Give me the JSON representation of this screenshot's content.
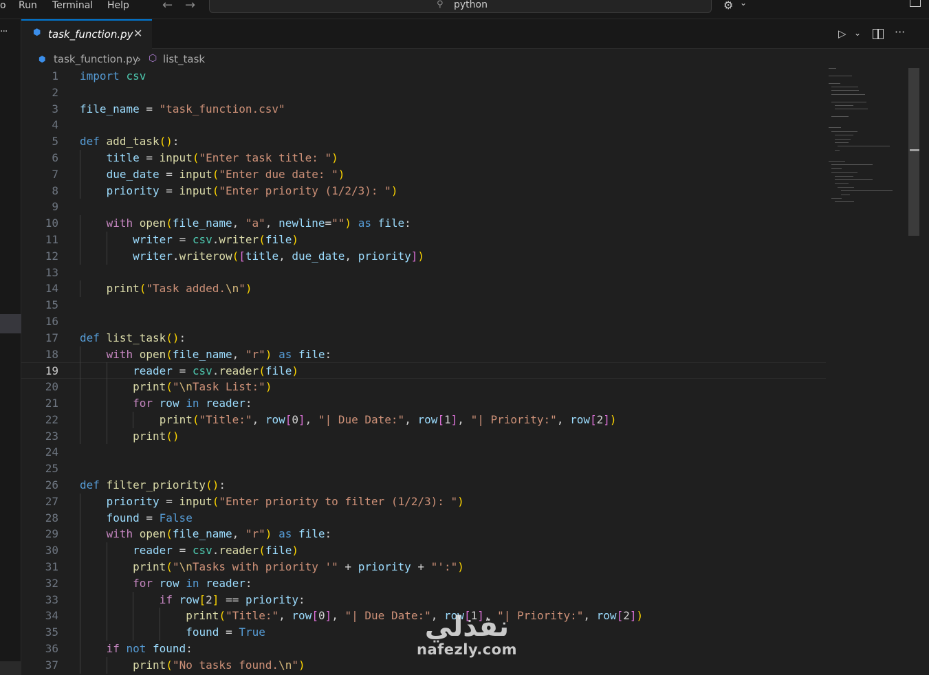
{
  "menu": {
    "items": [
      "o",
      "Run",
      "Terminal",
      "Help"
    ],
    "back_icon": "arrow-left-icon",
    "forward_icon": "arrow-right-icon",
    "command_center": "python"
  },
  "tab": {
    "filename": "task_function.py",
    "close_glyph": "✕"
  },
  "breadcrumb": {
    "file": "task_function.py",
    "separator": "›",
    "symbol": "list_task"
  },
  "editor": {
    "active_line": 19,
    "lines": [
      "import csv",
      "",
      "file_name = \"task_function.csv\"",
      "",
      "def add_task():",
      "    title = input(\"Enter task title: \")",
      "    due_date = input(\"Enter due date: \")",
      "    priority = input(\"Enter priority (1/2/3): \")",
      "",
      "    with open(file_name, \"a\", newline=\"\") as file:",
      "        writer = csv.writer(file)",
      "        writer.writerow([title, due_date, priority])",
      "",
      "    print(\"Task added.\\n\")",
      "",
      "",
      "def list_task():",
      "    with open(file_name, \"r\") as file:",
      "        reader = csv.reader(file)",
      "        print(\"\\nTask List:\")",
      "        for row in reader:",
      "            print(\"Title:\", row[0], \"| Due Date:\", row[1], \"| Priority:\", row[2])",
      "        print()",
      "",
      "",
      "def filter_priority():",
      "    priority = input(\"Enter priority to filter (1/2/3): \")",
      "    found = False",
      "    with open(file_name, \"r\") as file:",
      "        reader = csv.reader(file)",
      "        print(\"\\nTasks with priority '\" + priority + \"':\")",
      "        for row in reader:",
      "            if row[2] == priority:",
      "                print(\"Title:\", row[0], \"| Due Date:\", row[1], \"| Priority:\", row[2])",
      "                found = True",
      "    if not found:",
      "        print(\"No tasks found.\\n\")"
    ]
  },
  "watermark": {
    "arabic": "نفذلي",
    "latin": "nafezly.com"
  },
  "colors": {
    "accent": "#0078d4",
    "editor_bg": "#1f1f1f",
    "keyword": "#569cd6",
    "function": "#dcdcaa",
    "string": "#ce9178",
    "variable": "#9cdcfe",
    "class": "#4ec9b0"
  }
}
